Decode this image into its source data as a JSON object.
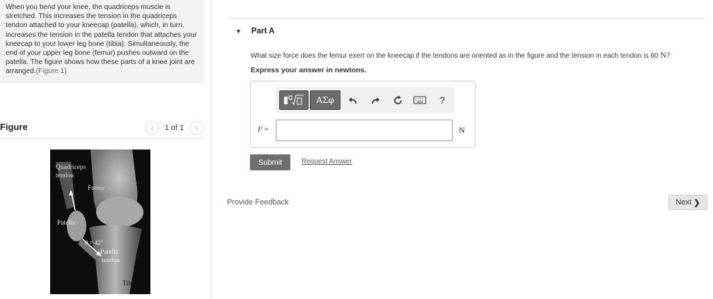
{
  "problem": {
    "text": "When you bend your knee, the quadriceps muscle is stretched. This increases the tension in the quadriceps tendon attached to your kneecap (patella), which, in turn, increases the tension in the patella tendon that attaches your kneecap to your lower leg bone (tibia). Simultaneously, the end of your upper leg bone (femur) pushes outward on the patella. The figure shows how these parts of a knee joint are arranged.",
    "figure_link": "(Figure 1)"
  },
  "figure": {
    "title": "Figure",
    "counter": "1 of 1",
    "prev_icon": "chevron-left-icon",
    "next_icon": "chevron-right-icon",
    "labels": {
      "quadriceps": "Quadriceps",
      "tendon_top": "tendon",
      "femur": "Femur",
      "patella": "Patella",
      "angle": "θ = 42°",
      "patella_tendon_1": "Patella",
      "patella_tendon_2": "tendon",
      "tibia": "Tibia"
    }
  },
  "part": {
    "label": "Part A",
    "caret_icon": "caret-down-icon",
    "question": "What size force does the femur exert on the kneecap if the tendons are oriented as in the figure and the tension in each tendon is 60",
    "question_unit": "N?",
    "instruction": "Express your answer in newtons."
  },
  "toolbar": {
    "template_icon": "templates-icon",
    "greek_label": "ΑΣφ",
    "undo_icon": "undo-icon",
    "redo_icon": "redo-icon",
    "reset_icon": "reset-icon",
    "keyboard_icon": "keyboard-icon",
    "help_label": "?"
  },
  "answer": {
    "variable": "F",
    "equals": "=",
    "value": "",
    "unit": "N"
  },
  "actions": {
    "submit": "Submit",
    "request": "Request Answer",
    "feedback": "Provide Feedback",
    "next": "Next"
  }
}
